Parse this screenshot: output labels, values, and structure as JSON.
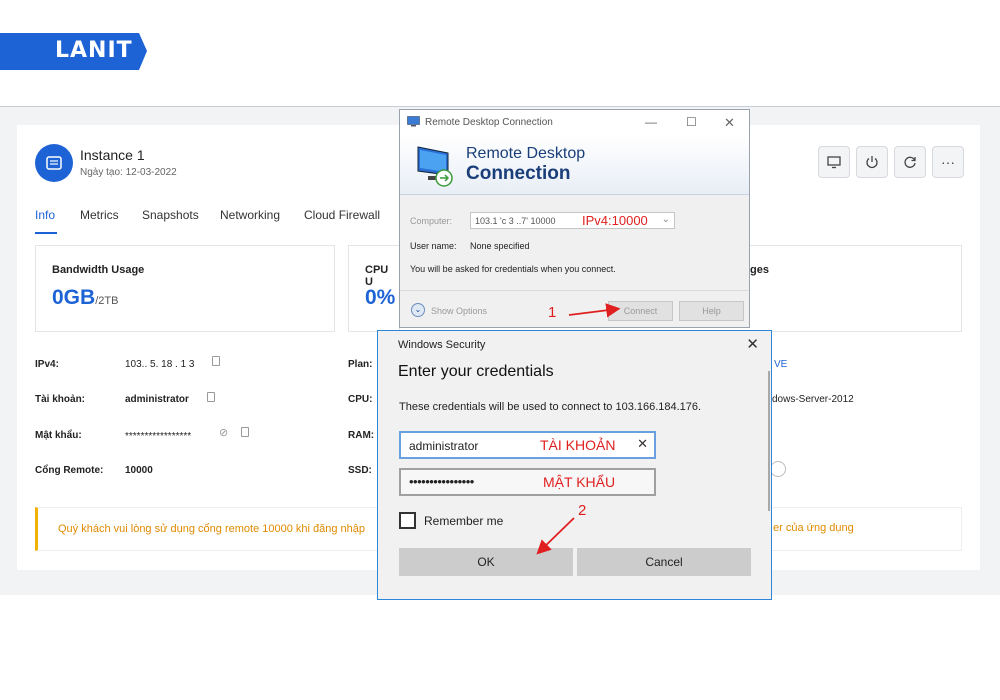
{
  "brand": {
    "logo_text": "LANIT"
  },
  "instance": {
    "title": "Instance 1",
    "created": "Ngày tạo: 12-03-2022",
    "tabs": [
      "Info",
      "Metrics",
      "Snapshots",
      "Networking",
      "Cloud Firewall"
    ],
    "active_tab": "Info",
    "toolbar": [
      {
        "name": "console",
        "icon": "monitor-icon"
      },
      {
        "name": "power",
        "icon": "power-icon"
      },
      {
        "name": "restart",
        "icon": "refresh-icon"
      },
      {
        "name": "more",
        "icon": "more-icon",
        "glyph": "···"
      }
    ]
  },
  "cards": {
    "bandwidth": {
      "title": "Bandwidth Usage",
      "value": "0GB",
      "unit": "/2TB"
    },
    "cpu": {
      "title": "CPU U",
      "value": "0%"
    },
    "images": {
      "title": "ges"
    }
  },
  "details": {
    "ipv4_label": "IPv4:",
    "ipv4_value": "103.. 5. 18 . 1 3",
    "account_label": "Tài khoản:",
    "account_value": "administrator",
    "password_label": "Mật khẩu:",
    "password_value": "*****************",
    "port_label": "Cổng Remote:",
    "port_value": "10000",
    "plan_label": "Plan:",
    "plan_value": "VE",
    "cpu_label": "CPU:",
    "cpu_value": "dows-Server-2012",
    "ram_label": "RAM:",
    "ssd_label": "SSD:"
  },
  "notice": {
    "text": "Quý khách vui lòng sử dụng cổng remote 10000 khi đăng nhập",
    "text_tail": "er của ứng dụng"
  },
  "rdc": {
    "window_title": "Remote Desktop Connection",
    "banner_line1": "Remote Desktop",
    "banner_line2": "Connection",
    "computer_label": "Computer:",
    "computer_value": "103.1 'c 3 ..7' 10000",
    "computer_annotation": "IPv4:10000",
    "username_label": "User name:",
    "username_value": "None specified",
    "note": "You will be asked for credentials when you connect.",
    "show_options": "Show Options",
    "connect": "Connect",
    "help": "Help"
  },
  "security": {
    "window_title": "Windows Security",
    "heading": "Enter your credentials",
    "description": "These credentials will be used to connect to 103.166.184.176.",
    "username_value": "administrator",
    "username_annotation": "TÀI KHOẢN",
    "password_mask": "••••••••••••••••",
    "password_annotation": "MẬT KHẨU",
    "remember_label": "Remember me",
    "ok": "OK",
    "cancel": "Cancel"
  },
  "annotations": {
    "step1": "1",
    "step2": "2"
  },
  "colors": {
    "brand_blue": "#1e63d6",
    "annotation_red": "#e02020",
    "notice_orange": "#e08a00"
  }
}
